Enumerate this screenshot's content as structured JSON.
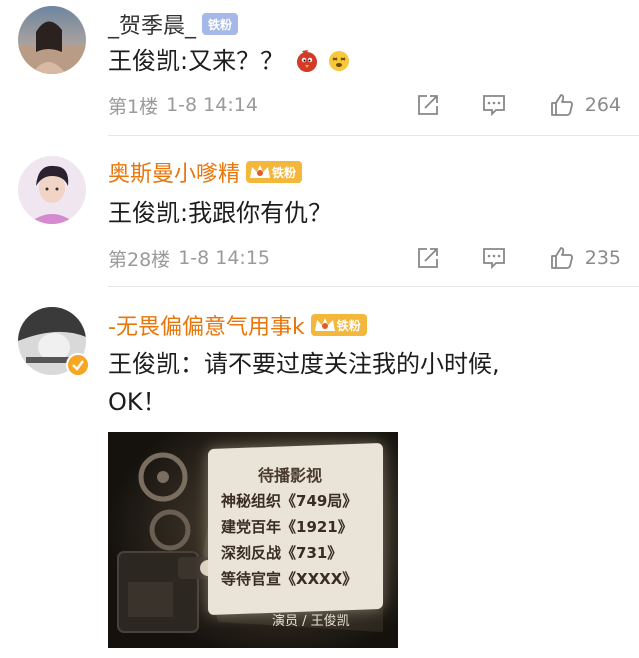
{
  "comments": [
    {
      "username": "_贺季晨_",
      "badge": "铁粉",
      "text": "王俊凯:又来？？",
      "floor": "第1楼",
      "time": "1-8 14:14",
      "likes": "264"
    },
    {
      "username": "奥斯曼小嗲精",
      "badge": "铁粉",
      "text": "王俊凯:我跟你有仇？",
      "floor": "第28楼",
      "time": "1-8 14:15",
      "likes": "235"
    },
    {
      "username": "-无畏偏偏意气用事k",
      "badge": "铁粉",
      "text_line1": "王俊凯：请不要过度关注我的小时候,",
      "text_line2": "OK！"
    }
  ],
  "film_image": {
    "heading": "待播影视",
    "lines": [
      "神秘组织《749局》",
      "建党百年《1921》",
      "深刻反战《731》",
      "等待官宣《XXXX》"
    ],
    "credit": "演员 / 王俊凯"
  },
  "colors": {
    "vip_name": "#e8760b",
    "badge_blue": "#a6b8e8",
    "badge_gold": "#f3b73b"
  }
}
